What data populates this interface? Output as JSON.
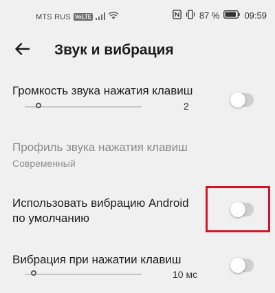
{
  "status_bar": {
    "carrier": "MTS RUS",
    "volte": "VoLTE",
    "signal_icon": "signal-icon",
    "wifi_icon": "wifi-icon",
    "nfc_icon": "nfc-icon",
    "vibrate_icon": "vibrate-icon",
    "battery_percent": "87 %",
    "time": "09:59"
  },
  "toolbar": {
    "back_icon": "arrow-back-icon",
    "title": "Звук и вибрация"
  },
  "settings": {
    "keypress_volume": {
      "title": "Громкость звука нажатия клавиш",
      "value": "2",
      "level": 0.12,
      "enabled": false
    },
    "keypress_sound_profile": {
      "title": "Профиль звука нажатия клавиш",
      "subtitle": "Современный",
      "disabled": true
    },
    "use_android_vibration": {
      "title_line1": "Использовать вибрацию Android",
      "title_line2": "по умолчанию",
      "enabled": false
    },
    "keypress_vibration": {
      "title": "Вибрация при нажатии клавиш",
      "value": "10 мс",
      "level": 0.04,
      "enabled": false
    }
  },
  "colors": {
    "background": "#f0f0f0",
    "highlight": "#d0142c",
    "toggle_off": "#cfcfcf"
  }
}
